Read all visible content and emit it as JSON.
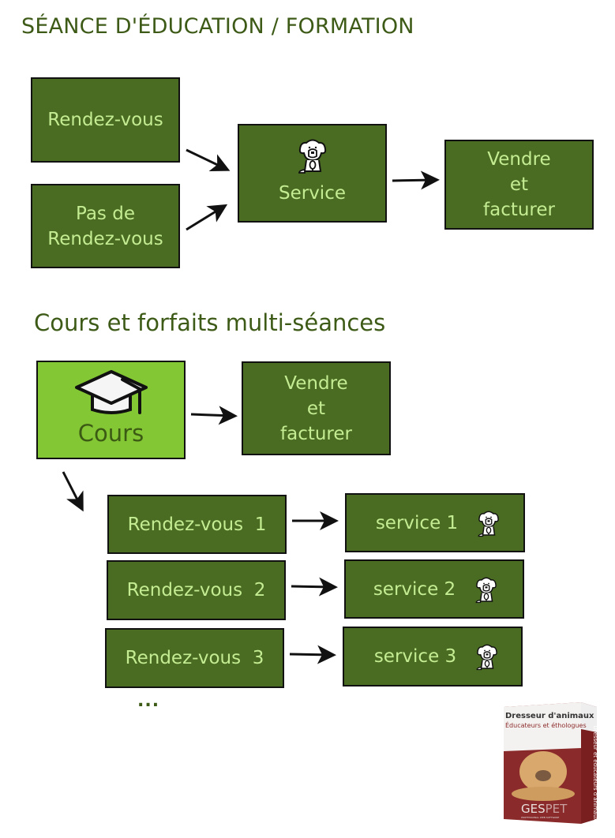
{
  "section1": {
    "title": "SÉANCE D'ÉDUCATION / FORMATION",
    "rdv": "Rendez-vous",
    "no_rdv_line1": "Pas de",
    "no_rdv_line2": "Rendez-vous",
    "service": "Service",
    "sell_line1": "Vendre",
    "sell_line2": "et",
    "sell_line3": "facturer",
    "service_icon": "dog-icon"
  },
  "section2": {
    "title": "Cours et forfaits multi-séances",
    "course": "Cours",
    "course_icon": "graduation-cap-icon",
    "sell_line1": "Vendre",
    "sell_line2": "et",
    "sell_line3": "facturer",
    "appointments": [
      {
        "rdv": "Rendez-vous  1",
        "service": "service 1"
      },
      {
        "rdv": "Rendez-vous  2",
        "service": "service 2"
      },
      {
        "rdv": "Rendez-vous  3",
        "service": "service 3"
      }
    ],
    "ellipsis": "..."
  },
  "product": {
    "title": "Dresseur d'animaux",
    "subtitle": "Éducateurs et éthologues",
    "side_text": "Dresseur et éducateurs d'animaux",
    "brand_a": "GES",
    "brand_b": "PET",
    "tagline": "PROFESSIONAL WEB SOFTWARE"
  },
  "colors": {
    "dark_green": "#4a6b22",
    "light_green": "#84c734",
    "text_light": "#c4ec92",
    "title_green": "#3d5a17",
    "box_red": "#8b2a2a"
  }
}
